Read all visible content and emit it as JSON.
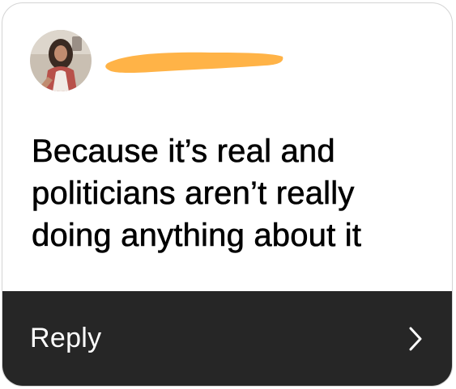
{
  "sender": {
    "avatar_icon": "profile-photo",
    "name_redaction_color": "#FFB347"
  },
  "message": {
    "text": "Because it’s real and politicians aren’t really doing anything about it"
  },
  "reply_bar": {
    "label": "Reply",
    "chevron_icon": "chevron-right-icon",
    "background": "#262626"
  }
}
